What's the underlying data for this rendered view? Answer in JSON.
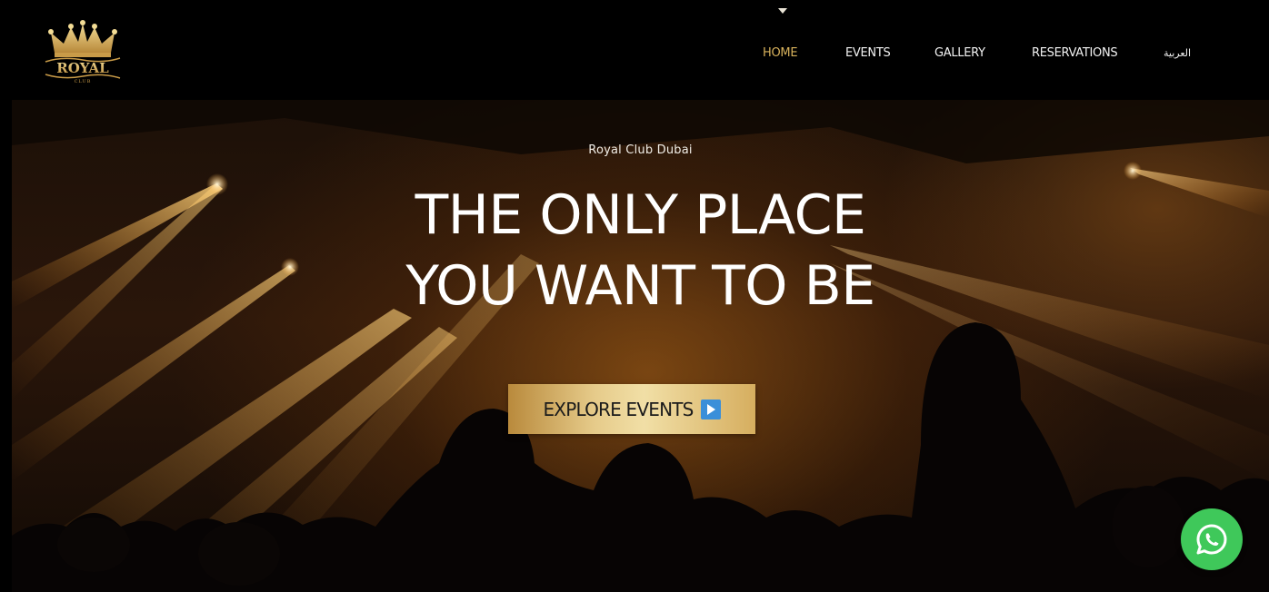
{
  "header": {
    "logo": {
      "text_main": "ROYAL",
      "text_sub": "CLUB",
      "icon": "crown-icon"
    },
    "nav": [
      {
        "label": "HOME",
        "active": true
      },
      {
        "label": "EVENTS",
        "active": false
      },
      {
        "label": "GALLERY",
        "active": false
      },
      {
        "label": "RESERVATIONS",
        "active": false
      },
      {
        "label": "العربية",
        "active": false
      }
    ]
  },
  "hero": {
    "subtitle": "Royal Club Dubai",
    "title_line1": "THE ONLY PLACE",
    "title_line2": "YOU WANT TO BE",
    "cta_label": "EXPLORE EVENTS",
    "cta_icon": "play-icon"
  },
  "floating": {
    "whatsapp_icon": "whatsapp-icon"
  },
  "colors": {
    "accent_gold": "#d8b25c",
    "nav_text": "#f2f2f2",
    "whatsapp_green": "#3fc85a",
    "cta_icon_blue": "#3a8fd9"
  }
}
